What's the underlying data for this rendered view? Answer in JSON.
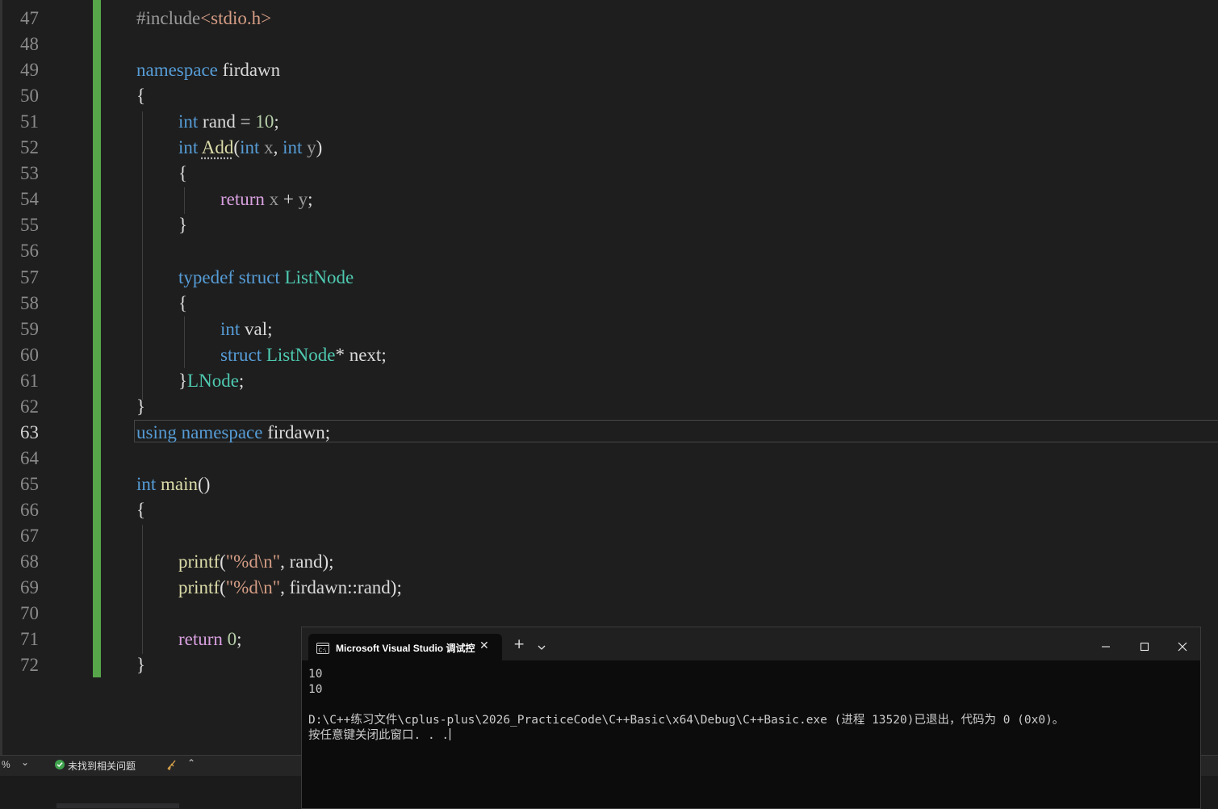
{
  "editor": {
    "active_line": 63,
    "lines": [
      {
        "num": 47,
        "indent": 0,
        "tokens": [
          {
            "t": "#include",
            "c": "pre"
          },
          {
            "t": "<stdio.h>",
            "c": "str"
          }
        ]
      },
      {
        "num": 48,
        "indent": 0,
        "tokens": []
      },
      {
        "num": 49,
        "indent": 0,
        "tokens": [
          {
            "t": "namespace",
            "c": "kw"
          },
          {
            "t": " firdawn",
            "c": "var"
          }
        ]
      },
      {
        "num": 50,
        "indent": 0,
        "tokens": [
          {
            "t": "{",
            "c": "plain"
          }
        ]
      },
      {
        "num": 51,
        "indent": 1,
        "tokens": [
          {
            "t": "int",
            "c": "kw"
          },
          {
            "t": " rand",
            "c": "var"
          },
          {
            "t": " = ",
            "c": "plain"
          },
          {
            "t": "10",
            "c": "num"
          },
          {
            "t": ";",
            "c": "plain"
          }
        ]
      },
      {
        "num": 52,
        "indent": 1,
        "tokens": [
          {
            "t": "int",
            "c": "kw"
          },
          {
            "t": " ",
            "c": "plain"
          },
          {
            "t": "Add",
            "c": "fn",
            "squiggle": true
          },
          {
            "t": "(",
            "c": "plain"
          },
          {
            "t": "int",
            "c": "kw"
          },
          {
            "t": " x",
            "c": "param"
          },
          {
            "t": ", ",
            "c": "plain"
          },
          {
            "t": "int",
            "c": "kw"
          },
          {
            "t": " y",
            "c": "param"
          },
          {
            "t": ")",
            "c": "plain"
          }
        ]
      },
      {
        "num": 53,
        "indent": 1,
        "tokens": [
          {
            "t": "{",
            "c": "plain"
          }
        ]
      },
      {
        "num": 54,
        "indent": 2,
        "tokens": [
          {
            "t": "return",
            "c": "ctl"
          },
          {
            "t": " x",
            "c": "param"
          },
          {
            "t": " + ",
            "c": "plain"
          },
          {
            "t": "y",
            "c": "param"
          },
          {
            "t": ";",
            "c": "plain"
          }
        ]
      },
      {
        "num": 55,
        "indent": 1,
        "tokens": [
          {
            "t": "}",
            "c": "plain"
          }
        ]
      },
      {
        "num": 56,
        "indent": 0,
        "tokens": []
      },
      {
        "num": 57,
        "indent": 1,
        "tokens": [
          {
            "t": "typedef",
            "c": "kw"
          },
          {
            "t": " ",
            "c": "plain"
          },
          {
            "t": "struct",
            "c": "kw"
          },
          {
            "t": " ",
            "c": "plain"
          },
          {
            "t": "ListNode",
            "c": "type"
          }
        ]
      },
      {
        "num": 58,
        "indent": 1,
        "tokens": [
          {
            "t": "{",
            "c": "plain"
          }
        ]
      },
      {
        "num": 59,
        "indent": 2,
        "tokens": [
          {
            "t": "int",
            "c": "kw"
          },
          {
            "t": " val",
            "c": "var"
          },
          {
            "t": ";",
            "c": "plain"
          }
        ]
      },
      {
        "num": 60,
        "indent": 2,
        "tokens": [
          {
            "t": "struct",
            "c": "kw"
          },
          {
            "t": " ",
            "c": "plain"
          },
          {
            "t": "ListNode",
            "c": "type"
          },
          {
            "t": "*",
            "c": "plain"
          },
          {
            "t": " next",
            "c": "var"
          },
          {
            "t": ";",
            "c": "plain"
          }
        ]
      },
      {
        "num": 61,
        "indent": 1,
        "tokens": [
          {
            "t": "}",
            "c": "plain"
          },
          {
            "t": "LNode",
            "c": "type"
          },
          {
            "t": ";",
            "c": "plain"
          }
        ]
      },
      {
        "num": 62,
        "indent": 0,
        "tokens": [
          {
            "t": "}",
            "c": "plain"
          }
        ]
      },
      {
        "num": 63,
        "indent": 0,
        "tokens": [
          {
            "t": "using",
            "c": "kw"
          },
          {
            "t": " ",
            "c": "plain"
          },
          {
            "t": "namespace",
            "c": "kw"
          },
          {
            "t": " firdawn",
            "c": "var"
          },
          {
            "t": ";",
            "c": "plain"
          }
        ]
      },
      {
        "num": 64,
        "indent": 0,
        "tokens": []
      },
      {
        "num": 65,
        "indent": 0,
        "tokens": [
          {
            "t": "int",
            "c": "kw"
          },
          {
            "t": " ",
            "c": "plain"
          },
          {
            "t": "main",
            "c": "fn"
          },
          {
            "t": "()",
            "c": "plain"
          }
        ]
      },
      {
        "num": 66,
        "indent": 0,
        "tokens": [
          {
            "t": "{",
            "c": "plain"
          }
        ]
      },
      {
        "num": 67,
        "indent": 0,
        "tokens": []
      },
      {
        "num": 68,
        "indent": 1,
        "tokens": [
          {
            "t": "printf",
            "c": "fn"
          },
          {
            "t": "(",
            "c": "plain"
          },
          {
            "t": "\"%d\\n\"",
            "c": "str"
          },
          {
            "t": ", ",
            "c": "plain"
          },
          {
            "t": "rand",
            "c": "var"
          },
          {
            "t": ");",
            "c": "plain"
          }
        ]
      },
      {
        "num": 69,
        "indent": 1,
        "tokens": [
          {
            "t": "printf",
            "c": "fn"
          },
          {
            "t": "(",
            "c": "plain"
          },
          {
            "t": "\"%d\\n\"",
            "c": "str"
          },
          {
            "t": ", ",
            "c": "plain"
          },
          {
            "t": "firdawn",
            "c": "var"
          },
          {
            "t": "::",
            "c": "plain"
          },
          {
            "t": "rand",
            "c": "var"
          },
          {
            "t": ");",
            "c": "plain"
          }
        ]
      },
      {
        "num": 70,
        "indent": 0,
        "tokens": []
      },
      {
        "num": 71,
        "indent": 1,
        "tokens": [
          {
            "t": "return",
            "c": "ctl"
          },
          {
            "t": " ",
            "c": "plain"
          },
          {
            "t": "0",
            "c": "num"
          },
          {
            "t": ";",
            "c": "plain"
          }
        ]
      },
      {
        "num": 72,
        "indent": 0,
        "tokens": [
          {
            "t": "}",
            "c": "plain"
          }
        ]
      }
    ]
  },
  "status": {
    "zoom": "%",
    "issues": "未找到相关问题"
  },
  "console": {
    "tab_title": "Microsoft Visual Studio 调试控",
    "output_lines": [
      "10",
      "10",
      "",
      "D:\\C++练习文件\\cplus-plus\\2026_PracticeCode\\C++Basic\\x64\\Debug\\C++Basic.exe (进程 13520)已退出，代码为 0 (0x0)。",
      "按任意键关闭此窗口. . ."
    ]
  },
  "icons": {
    "console_tab_icon": "terminal-icon",
    "tab_close": "close-icon",
    "new_tab": "plus-icon",
    "tab_dropdown": "chevron-down-icon",
    "minimize": "minimize-icon",
    "maximize": "maximize-icon",
    "window_close": "close-icon",
    "issues_ok": "check-circle-icon",
    "cleanup": "brush-icon",
    "expand": "chevron-up-icon"
  },
  "colors": {
    "keyword": "#569cd6",
    "type": "#4ec9b0",
    "control": "#d8a0df",
    "number": "#b5cea8",
    "string": "#d69d85",
    "function": "#dcdcaa",
    "change_bar": "#57a64a",
    "ok_status": "#3fa34d"
  }
}
